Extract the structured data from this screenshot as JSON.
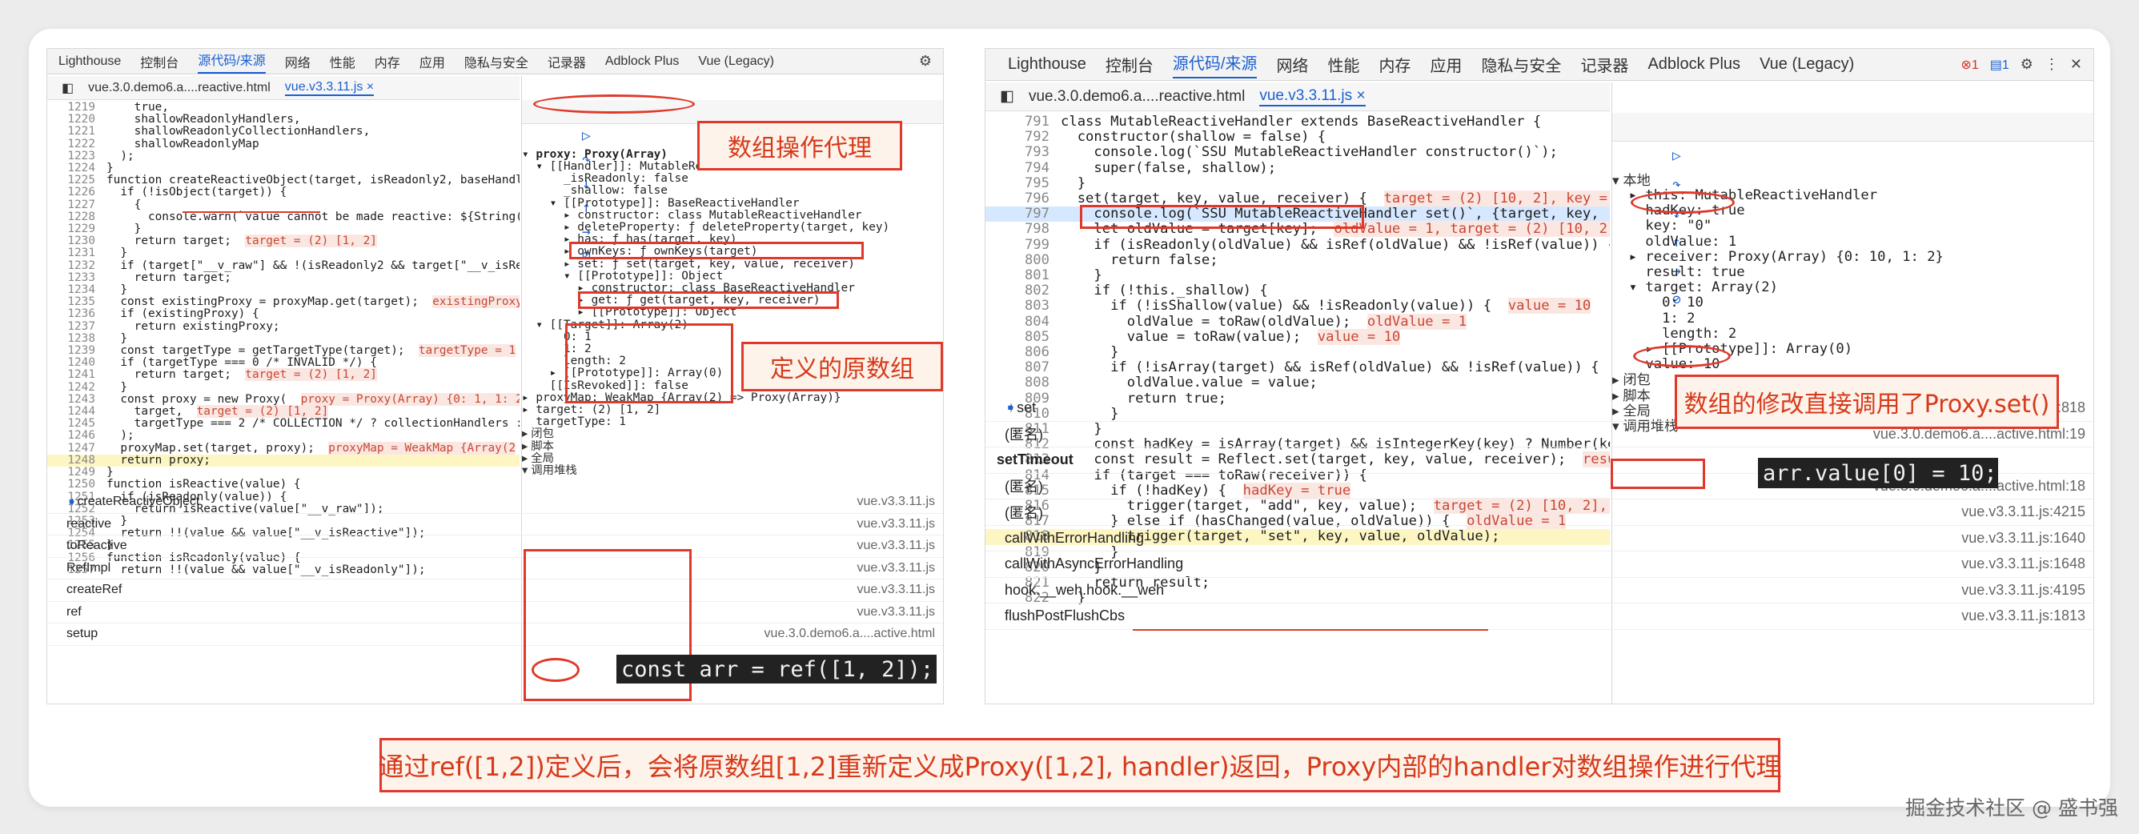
{
  "left": {
    "tabs": [
      "Lighthouse",
      "控制台",
      "源代码/来源",
      "网络",
      "性能",
      "内存",
      "应用",
      "隐私与安全",
      "记录器",
      "Adblock Plus",
      "Vue (Legacy)"
    ],
    "files": [
      "vue.3.0.demo6.a....reactive.html",
      "vue.v3.3.11.js"
    ],
    "code": [
      {
        "n": "1219",
        "t": "    true,"
      },
      {
        "n": "1220",
        "t": "    shallowReadonlyHandlers,"
      },
      {
        "n": "1221",
        "t": "    shallowReadonlyCollectionHandlers,"
      },
      {
        "n": "1222",
        "t": "    shallowReadonlyMap"
      },
      {
        "n": "1223",
        "t": "  );"
      },
      {
        "n": "1224",
        "t": "}"
      },
      {
        "n": "1225",
        "t": "function createReactiveObject(target, isReadonly2, baseHandl"
      },
      {
        "n": "1226",
        "t": "  if (!isObject(target)) {"
      },
      {
        "n": "1227",
        "t": "    {"
      },
      {
        "n": "1228",
        "t": "      console.warn(`value cannot be made reactive: ${String("
      },
      {
        "n": "1229",
        "t": "    }"
      },
      {
        "n": "1230",
        "t": "    return target;",
        "i": "target = (2) [1, 2]"
      },
      {
        "n": "1231",
        "t": "  }"
      },
      {
        "n": "1232",
        "t": "  if (target[\"__v_raw\"] && !(isReadonly2 && target[\"__v_isRe"
      },
      {
        "n": "1233",
        "t": "    return target;"
      },
      {
        "n": "1234",
        "t": "  }"
      },
      {
        "n": "1235",
        "t": "  const existingProxy = proxyMap.get(target);",
        "i": "existingProxy"
      },
      {
        "n": "1236",
        "t": "  if (existingProxy) {"
      },
      {
        "n": "1237",
        "t": "    return existingProxy;"
      },
      {
        "n": "1238",
        "t": "  }"
      },
      {
        "n": "1239",
        "t": "  const targetType = getTargetType(target);",
        "i": "targetType = 1"
      },
      {
        "n": "1240",
        "t": "  if (targetType === 0 /* INVALID */) {"
      },
      {
        "n": "1241",
        "t": "    return target;",
        "i": "target = (2) [1, 2]"
      },
      {
        "n": "1242",
        "t": "  }"
      },
      {
        "n": "1243",
        "t": "  const proxy = new Proxy(",
        "i": "proxy = Proxy(Array) {0: 1, 1: 2"
      },
      {
        "n": "1244",
        "t": "    target,",
        "i": "target = (2) [1, 2]"
      },
      {
        "n": "1245",
        "t": "    targetType === 2 /* COLLECTION */ ? collectionHandlers :"
      },
      {
        "n": "1246",
        "t": "  );"
      },
      {
        "n": "1247",
        "t": "  proxyMap.set(target, proxy);",
        "i": "proxyMap = WeakMap {Array(2"
      },
      {
        "n": "1248",
        "t": "  return proxy;",
        "hl": true
      },
      {
        "n": "1249",
        "t": "}"
      },
      {
        "n": "1250",
        "t": "function isReactive(value) {"
      },
      {
        "n": "1251",
        "t": "  if (isReadonly(value)) {"
      },
      {
        "n": "1252",
        "t": "    return isReactive(value[\"__v_raw\"]);"
      },
      {
        "n": "1253",
        "t": "  }"
      },
      {
        "n": "1254",
        "t": "  return !!(value && value[\"__v_isReactive\"]);"
      },
      {
        "n": "1255",
        "t": "}"
      },
      {
        "n": "1256",
        "t": "function isReadonly(value) {"
      },
      {
        "n": "1257",
        "t": "  return !!(value && value[\"__v_isReadonly\"]);"
      }
    ],
    "scope": [
      {
        "t": "▾ proxy: Proxy(Array)",
        "k": true
      },
      {
        "t": "  ▾ [[Handler]]: MutableReactiveHandler"
      },
      {
        "t": "      _isReadonly: false"
      },
      {
        "t": "      _shallow: false"
      },
      {
        "t": "    ▾ [[Prototype]]: BaseReactiveHandler"
      },
      {
        "t": "      ▸ constructor: class MutableReactiveHandler"
      },
      {
        "t": "      ▸ deleteProperty: ƒ deleteProperty(target, key)"
      },
      {
        "t": "      ▸ has: ƒ has(target, key)"
      },
      {
        "t": "      ▸ ownKeys: ƒ ownKeys(target)"
      },
      {
        "t": "      ▸ set: ƒ set(target, key, value, receiver)"
      },
      {
        "t": "      ▾ [[Prototype]]: Object"
      },
      {
        "t": "        ▸ constructor: class BaseReactiveHandler"
      },
      {
        "t": "        ▸ get: ƒ get(target, key, receiver)"
      },
      {
        "t": "        ▸ [[Prototype]]: Object"
      },
      {
        "t": "  ▾ [[Target]]: Array(2)"
      },
      {
        "t": "      0: 1"
      },
      {
        "t": "      1: 2"
      },
      {
        "t": "      length: 2"
      },
      {
        "t": "    ▸ [[Prototype]]: Array(0)"
      },
      {
        "t": "    [[IsRevoked]]: false"
      },
      {
        "t": "▸ proxyMap: WeakMap {Array(2) => Proxy(Array)}"
      },
      {
        "t": "▸ target: (2) [1, 2]"
      },
      {
        "t": "  targetType: 1"
      },
      {
        "t": "▸ 闭包",
        "s": true
      },
      {
        "t": "▸ 脚本",
        "s": true
      },
      {
        "t": "▸ 全局",
        "s": true
      },
      {
        "t": "▾ 调用堆栈",
        "s": true
      }
    ],
    "stack": [
      {
        "fn": "createReactiveObject",
        "file": "vue.v3.3.11.js"
      },
      {
        "fn": "reactive",
        "file": "vue.v3.3.11.js"
      },
      {
        "fn": "toReactive",
        "file": "vue.v3.3.11.js"
      },
      {
        "fn": "RefImpl",
        "file": "vue.v3.3.11.js"
      },
      {
        "fn": "createRef",
        "file": "vue.v3.3.11.js"
      },
      {
        "fn": "ref",
        "file": "vue.v3.3.11.js"
      },
      {
        "fn": "setup",
        "file": "vue.3.0.demo6.a....active.html"
      }
    ],
    "ann1": "数组操作代理",
    "ann2": "定义的原数组",
    "term": "const arr = ref([1, 2]);"
  },
  "right": {
    "tabs": [
      "Lighthouse",
      "控制台",
      "源代码/来源",
      "网络",
      "性能",
      "内存",
      "应用",
      "隐私与安全",
      "记录器",
      "Adblock Plus",
      "Vue (Legacy)"
    ],
    "badges": {
      "errors": "1",
      "messages": "1"
    },
    "files": [
      "vue.3.0.demo6.a....reactive.html",
      "vue.v3.3.11.js"
    ],
    "code": [
      {
        "n": "791",
        "t": "class MutableReactiveHandler extends BaseReactiveHandler {"
      },
      {
        "n": "792",
        "t": "  constructor(shallow = false) {"
      },
      {
        "n": "793",
        "t": "    console.log(`SSU MutableReactiveHandler constructor()`);"
      },
      {
        "n": "794",
        "t": "    super(false, shallow);"
      },
      {
        "n": "795",
        "t": "  }"
      },
      {
        "n": "796",
        "t": "  set(target, key, value, receiver) {",
        "i": "target = (2) [10, 2], key = \""
      },
      {
        "n": "797",
        "t": "    console.log(`SSU MutableReactiveHandler set()`, {target, key,",
        "cur": true
      },
      {
        "n": "798",
        "t": "    let oldValue = target[key];",
        "i": "oldValue = 1, target = (2) [10, 2],"
      },
      {
        "n": "799",
        "t": "    if (isReadonly(oldValue) && isRef(oldValue) && !isRef(value)) {"
      },
      {
        "n": "800",
        "t": "      return false;"
      },
      {
        "n": "801",
        "t": "    }"
      },
      {
        "n": "802",
        "t": "    if (!this._shallow) {"
      },
      {
        "n": "803",
        "t": "      if (!isShallow(value) && !isReadonly(value)) {",
        "i": "value = 10"
      },
      {
        "n": "804",
        "t": "        oldValue = toRaw(oldValue);",
        "i": "oldValue = 1"
      },
      {
        "n": "805",
        "t": "        value = toRaw(value);",
        "i": "value = 10"
      },
      {
        "n": "806",
        "t": "      }"
      },
      {
        "n": "807",
        "t": "      if (!isArray(target) && isRef(oldValue) && !isRef(value)) {",
        "i": "t"
      },
      {
        "n": "808",
        "t": "        oldValue.value = value;"
      },
      {
        "n": "809",
        "t": "        return true;"
      },
      {
        "n": "810",
        "t": "      }"
      },
      {
        "n": "811",
        "t": "    }"
      },
      {
        "n": "812",
        "t": "    const hadKey = isArray(target) && isIntegerKey(key) ? Number(key)"
      },
      {
        "n": "813",
        "t": "    const result = Reflect.set(target, key, value, receiver);",
        "i": "resul"
      },
      {
        "n": "814",
        "t": "    if (target === toRaw(receiver)) {"
      },
      {
        "n": "815",
        "t": "      if (!hadKey) {",
        "i": "hadKey = true"
      },
      {
        "n": "816",
        "t": "        trigger(target, \"add\", key, value);",
        "i": "target = (2) [10, 2], k"
      },
      {
        "n": "817",
        "t": "      } else if (hasChanged(value, oldValue)) {",
        "i": "oldValue = 1"
      },
      {
        "n": "818",
        "t": "        trigger(target, \"set\", key, value, oldValue);",
        "hl": true
      },
      {
        "n": "819",
        "t": "      }"
      },
      {
        "n": "820",
        "t": "    }"
      },
      {
        "n": "821",
        "t": "    return result;"
      },
      {
        "n": "822",
        "t": "  }"
      }
    ],
    "scope": [
      {
        "t": "▾ 本地",
        "s": true
      },
      {
        "t": "  ▸ this: MutableReactiveHandler"
      },
      {
        "t": "    hadKey: true"
      },
      {
        "t": "    key: \"0\""
      },
      {
        "t": "    oldValue: 1"
      },
      {
        "t": "  ▸ receiver: Proxy(Array) {0: 10, 1: 2}"
      },
      {
        "t": "    result: true"
      },
      {
        "t": "  ▾ target: Array(2)"
      },
      {
        "t": "      0: 10"
      },
      {
        "t": "      1: 2"
      },
      {
        "t": "      length: 2"
      },
      {
        "t": "    ▸ [[Prototype]]: Array(0)"
      },
      {
        "t": "    value: 10"
      },
      {
        "t": "▸ 闭包",
        "s": true
      },
      {
        "t": "▸ 脚本",
        "s": true
      },
      {
        "t": "▸ 全局",
        "s": true
      },
      {
        "t": "▾ 调用堆栈",
        "s": true
      }
    ],
    "stack": [
      {
        "fn": "set",
        "file": "vue.v3.3.11.js:818",
        "cur": true
      },
      {
        "fn": "(匿名)",
        "file": "vue.3.0.demo6.a....active.html:19"
      },
      {
        "fn": "setTimeout",
        "file": "",
        "head": true
      },
      {
        "fn": "(匿名)",
        "file": "vue.3.0.demo6.a....active.html:18"
      },
      {
        "fn": "(匿名)",
        "file": "vue.v3.3.11.js:4215"
      },
      {
        "fn": "callWithErrorHandling",
        "file": "vue.v3.3.11.js:1640"
      },
      {
        "fn": "callWithAsyncErrorHandling",
        "file": "vue.v3.3.11.js:1648"
      },
      {
        "fn": "hook.__weh.hook.__weh",
        "file": "vue.v3.3.11.js:4195"
      },
      {
        "fn": "flushPostFlushCbs",
        "file": "vue.v3.3.11.js:1813"
      }
    ],
    "ann": "数组的修改直接调用了Proxy.set()",
    "term": "arr.value[0] = 10;"
  },
  "caption": "通过ref([1,2])定义后，会将原数组[1,2]重新定义成Proxy([1,2], handler)返回，Proxy内部的handler对数组操作进行代理",
  "watermark": "掘金技术社区 @ 盛书强"
}
